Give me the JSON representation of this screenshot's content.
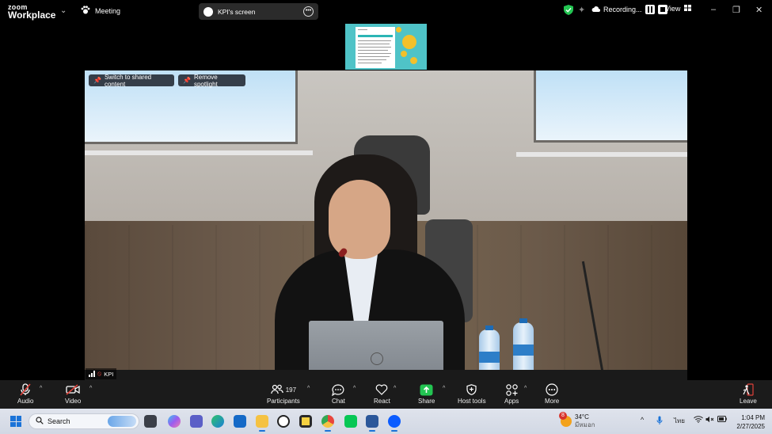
{
  "app": {
    "brand_line1": "zoom",
    "brand_line2": "Workplace",
    "meeting_label": "Meeting"
  },
  "share_pill": {
    "label": "KPI's screen"
  },
  "status": {
    "recording_label": "Recording...",
    "view_label": "View"
  },
  "video": {
    "switch_button": "Switch to shared content",
    "spotlight_button": "Remove spotlight",
    "participant_name": "KPI"
  },
  "toolbar": {
    "audio": "Audio",
    "video": "Video",
    "participants": "Participants",
    "participants_count": "197",
    "chat": "Chat",
    "react": "React",
    "share": "Share",
    "host_tools": "Host tools",
    "apps": "Apps",
    "more": "More",
    "leave": "Leave"
  },
  "taskbar": {
    "search_placeholder": "Search",
    "weather_temp": "34°C",
    "weather_desc": "มีหมอก",
    "weather_badge": "8",
    "language": "ไทย",
    "time": "1:04 PM",
    "date": "2/27/2025"
  },
  "colors": {
    "share_green": "#23c552",
    "muted_red": "#e0413a",
    "accent_blue": "#1a73d8"
  }
}
